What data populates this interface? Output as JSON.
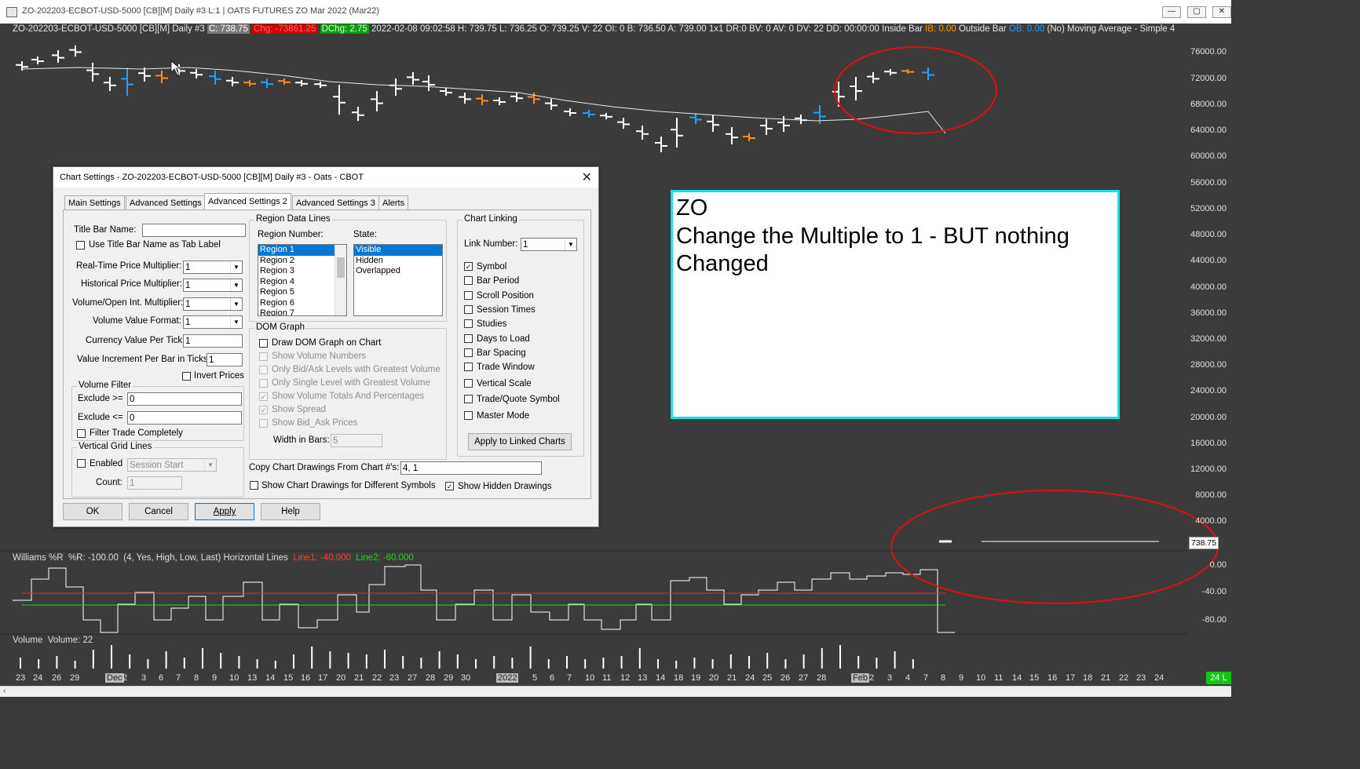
{
  "window": {
    "title": "ZO-202203-ECBOT-USD-5000 [CB][M]  Daily  #3 L:1 | OATS FUTURES ZO Mar 2022 (Mar22)",
    "buttons": [
      "—",
      "▢",
      "✕"
    ]
  },
  "infobar": {
    "symbol": "ZO-202203-ECBOT-USD-5000 [CB][M]  Daily  #3",
    "close": "C: 738.75",
    "chg": "Chg: -73861.25",
    "dchg": "DChg: 2.75",
    "details": "2022-02-08 09:02:58 H: 739.75 L: 736.25 O: 739.25 V: 22 OI: 0 B: 736.50 A: 739.00 1x1 DR:0 BV: 0 AV: 0 DV: 22 DD: 00:00:00 Inside Bar",
    "ib_label": "IB: 0.00",
    "outside": "Outside Bar",
    "ob_label": "OB: 0.00",
    "tail": "(No)  Moving Average - Simple  4"
  },
  "price_scale": [
    "76000.00",
    "72000.00",
    "68000.00",
    "64000.00",
    "60000.00",
    "56000.00",
    "52000.00",
    "48000.00",
    "44000.00",
    "40000.00",
    "36000.00",
    "32000.00",
    "28000.00",
    "24000.00",
    "20000.00",
    "16000.00",
    "12000.00",
    "8000.00",
    "4000.00"
  ],
  "current_price_tag": "738.75",
  "indicator": {
    "label": "Williams %R",
    "value": "%R: -100.00",
    "params": "(4, Yes, High, Low, Last)  Horizontal Lines",
    "line1": "Line1: -40.000",
    "line2": "Line2: -60.000",
    "scale": [
      "0.00",
      "-40.00",
      "-80.00"
    ]
  },
  "volume": {
    "label": "Volume",
    "value": "Volume: 22"
  },
  "dates": [
    "23",
    "24",
    "26",
    "29",
    "Dec",
    "2",
    "3",
    "6",
    "7",
    "8",
    "9",
    "10",
    "13",
    "14",
    "15",
    "16",
    "17",
    "20",
    "21",
    "22",
    "23",
    "27",
    "28",
    "29",
    "30",
    "2022",
    "5",
    "6",
    "7",
    "10",
    "11",
    "12",
    "13",
    "14",
    "18",
    "19",
    "20",
    "21",
    "24",
    "25",
    "26",
    "27",
    "28",
    "Feb",
    "2",
    "3",
    "4",
    "7",
    "8",
    "9",
    "10",
    "11",
    "14",
    "15",
    "16",
    "17",
    "18",
    "21",
    "22",
    "23",
    "24"
  ],
  "date_corner": "24 L",
  "annotation": {
    "lines": [
      "ZO",
      "Change the Multiple to 1 - BUT nothing",
      "Changed"
    ]
  },
  "dialog": {
    "title": "Chart Settings - ZO-202203-ECBOT-USD-5000 [CB][M]  Daily  #3 - Oats - CBOT",
    "tabs": [
      "Main Settings",
      "Advanced Settings",
      "Advanced Settings 2",
      "Advanced Settings 3",
      "Alerts"
    ],
    "active_tab": "Advanced Settings 2",
    "left": {
      "title_bar_name_label": "Title Bar Name:",
      "title_bar_name_value": "",
      "use_title_label": "Use Title Bar Name as Tab Label",
      "rt_mult_label": "Real-Time Price Multiplier:",
      "rt_mult_value": "1",
      "hist_mult_label": "Historical Price Multiplier:",
      "hist_mult_value": "1",
      "vol_mult_label": "Volume/Open Int. Multiplier:",
      "vol_mult_value": "1",
      "vol_fmt_label": "Volume Value Format:",
      "vol_fmt_value": "1",
      "currency_label": "Currency Value Per Tick:",
      "currency_value": "1",
      "value_inc_label": "Value Increment Per Bar in Ticks:",
      "value_inc_value": "1",
      "invert_label": "Invert Prices",
      "volume_filter_title": "Volume Filter",
      "exclude_ge_label": "Exclude >=",
      "exclude_ge_value": "0",
      "exclude_le_label": "Exclude <=",
      "exclude_le_value": "0",
      "filter_trade_label": "Filter Trade Completely",
      "vgrid_title": "Vertical Grid Lines",
      "enabled_label": "Enabled",
      "enabled_value": "Session Start",
      "count_label": "Count:",
      "count_value": "1"
    },
    "region": {
      "title": "Region Data Lines",
      "region_number_label": "Region Number:",
      "state_label": "State:",
      "regions": [
        "Region 1",
        "Region 2",
        "Region 3",
        "Region 4",
        "Region 5",
        "Region 6",
        "Region 7"
      ],
      "states": [
        "Visible",
        "Hidden",
        "Overlapped"
      ]
    },
    "dom": {
      "title": "DOM Graph",
      "items": [
        "Draw DOM Graph on Chart",
        "Show Volume Numbers",
        "Only Bid/Ask Levels with Greatest Volume",
        "Only Single Level with Greatest Volume",
        "Show Volume Totals And Percentages",
        "Show Spread",
        "Show Bid_Ask Prices"
      ],
      "width_label": "Width in Bars:",
      "width_value": "5"
    },
    "linking": {
      "title": "Chart Linking",
      "link_number_label": "Link Number:",
      "link_number_value": "1",
      "items": [
        "Symbol",
        "Bar Period",
        "Scroll Position",
        "Session Times",
        "Studies",
        "Days to Load",
        "Bar Spacing",
        "Trade Window",
        "Vertical Scale",
        "Trade/Quote Symbol",
        "Master Mode"
      ],
      "apply_linked": "Apply to Linked Charts"
    },
    "copy_label": "Copy Chart Drawings From Chart #'s:",
    "copy_value": "4, 1",
    "show_diff_label": "Show Chart Drawings for Different Symbols",
    "show_hidden_label": "Show Hidden Drawings",
    "buttons": {
      "ok": "OK",
      "cancel": "Cancel",
      "apply": "Apply",
      "help": "Help"
    }
  },
  "colors": {
    "background": "#3b3b3b",
    "bar_up": "#ffffff",
    "bar_blue": "#22a0ff",
    "bar_orange": "#ff8c1a",
    "highlight_circle": "#e01010",
    "annotation_border": "#18e0e8"
  }
}
